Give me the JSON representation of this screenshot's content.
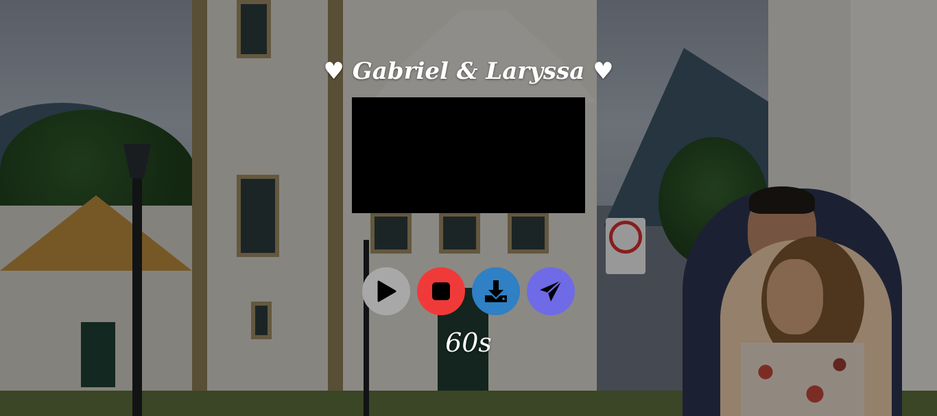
{
  "header": {
    "title": "♥ Gabriel & Laryssa ♥"
  },
  "controls": {
    "play": {
      "icon": "play-icon",
      "color": "#a8a8a8"
    },
    "stop": {
      "icon": "stop-icon",
      "color": "#f03a3a"
    },
    "download": {
      "icon": "download-icon",
      "color": "#2f80c4"
    },
    "send": {
      "icon": "send-icon",
      "color": "#6f6ae6"
    }
  },
  "timer": {
    "text": "60s"
  }
}
